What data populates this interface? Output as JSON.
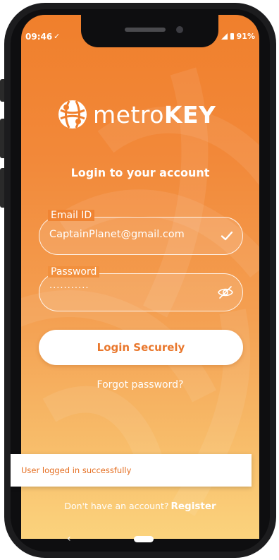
{
  "status_bar": {
    "time": "09:46",
    "battery": "91%"
  },
  "app": {
    "brand_light": "metro",
    "brand_bold": "KEY"
  },
  "login": {
    "heading": "Login to your account",
    "email_label": "Email ID",
    "email_value": "CaptainPlanet@gmail.com",
    "password_label": "Password",
    "password_value": "···········",
    "submit_label": "Login Securely",
    "forgot_label": "Forgot password?"
  },
  "toast": {
    "message": "User logged in successfully"
  },
  "footer": {
    "prompt": "Don't have an account?",
    "register_label": "Register"
  },
  "navigation": {
    "back_glyph": "‹"
  },
  "colors": {
    "accent": "#f07f2c",
    "accent_light": "#fbd37d",
    "button_text": "#e9772c"
  }
}
